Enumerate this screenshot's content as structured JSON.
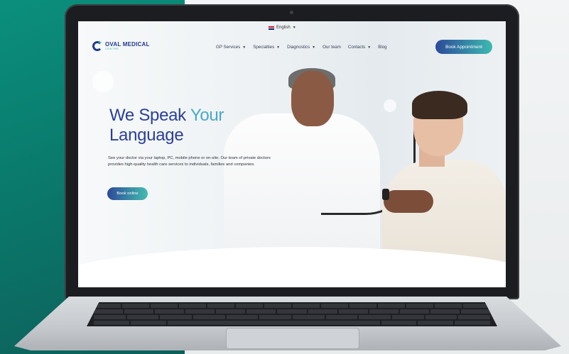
{
  "site": {
    "language": "English",
    "logo": {
      "name": "OVAL MEDICAL",
      "sub": "CENTRE"
    },
    "nav": [
      {
        "label": "GP Services",
        "dropdown": true
      },
      {
        "label": "Specialties",
        "dropdown": true
      },
      {
        "label": "Diagnostics",
        "dropdown": true
      },
      {
        "label": "Our team",
        "dropdown": false
      },
      {
        "label": "Contacts",
        "dropdown": true
      },
      {
        "label": "Blog",
        "dropdown": false
      }
    ],
    "cta": "Book Appointment"
  },
  "hero": {
    "headline_part1": "We Speak ",
    "headline_accent": "Your",
    "headline_line2": "Language",
    "description": "See your doctor via your laptop, PC, mobile phone or on-site. Our team of private doctors provides high-quality health care services to individuals, families and companies.",
    "button": "Book online"
  },
  "colors": {
    "brand_blue": "#2b3f98",
    "brand_teal": "#3dbab0",
    "background_teal": "#0b8f7d"
  }
}
